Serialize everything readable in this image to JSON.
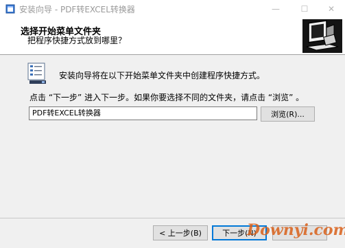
{
  "window": {
    "title": "安装向导 - PDF转EXCEL转换器",
    "minimize_glyph": "—",
    "maximize_glyph": "☐",
    "close_glyph": "✕"
  },
  "header": {
    "title": "选择开始菜单文件夹",
    "subtitle": "把程序快捷方式放到哪里？"
  },
  "content": {
    "intro": "安装向导将在以下开始菜单文件夹中创建程序快捷方式。",
    "instruction": "点击 “下一步” 进入下一步。如果你要选择不同的文件夹，请点击 “浏览” 。",
    "folder_value": "PDF转EXCEL转换器",
    "browse_label": "浏览(R)..."
  },
  "footer": {
    "back_label": "< 上一步(B)",
    "next_label": "下一步(N)",
    "cancel_label": ""
  },
  "watermark": "Downyi.com",
  "colors": {
    "accent": "#0078d7",
    "watermark": "#d9601a",
    "window_bg": "#f0f0f0"
  }
}
